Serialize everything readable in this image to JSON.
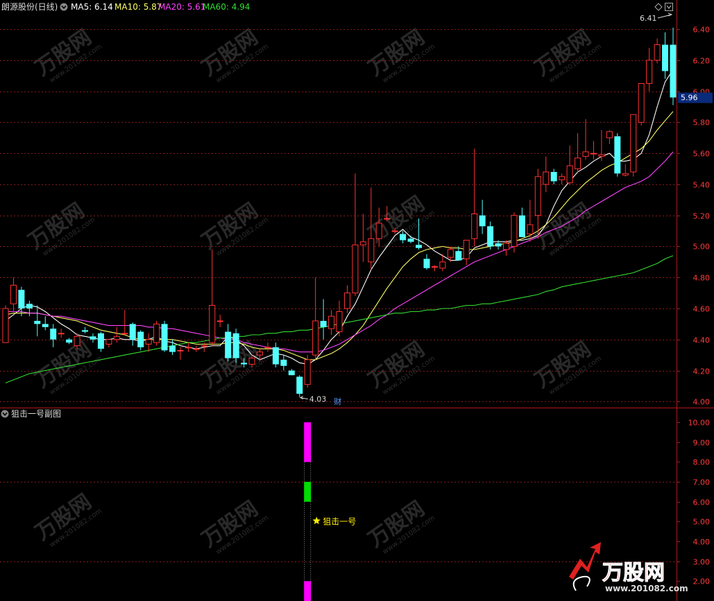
{
  "main_panel": {
    "stock_title": "朗源股份(日线)",
    "ma_legend": [
      {
        "label": "MA5: 6.14",
        "color": "#ffffff"
      },
      {
        "label": "MA10: 5.87",
        "color": "#ffff66"
      },
      {
        "label": "MA20: 5.61",
        "color": "#ff44ff"
      },
      {
        "label": "MA60: 4.94",
        "color": "#33dd33"
      }
    ],
    "current_price_label": "5.96",
    "high_annotation": "6.41",
    "low_annotation": "4.03",
    "event_marker": "财"
  },
  "sub_panel": {
    "title": "狙击一号副图",
    "signal_label": "狙击一号"
  },
  "watermark": {
    "brand": "万股网",
    "url": "www.201082.com"
  },
  "colors": {
    "up": "#ff3232",
    "down": "#54ffff",
    "grid": "#841c1c",
    "axis": "#b01818",
    "magenta_bar": "#ff00ff",
    "green_bar": "#00dd00",
    "star": "#ffee00"
  },
  "chart_data": [
    {
      "type": "candlestick",
      "title": "朗源股份(日线)",
      "ylim": [
        3.97,
        6.49
      ],
      "yticks": [
        4.0,
        4.2,
        4.4,
        4.6,
        4.8,
        5.0,
        5.2,
        5.4,
        5.6,
        5.8,
        6.0,
        6.2,
        6.4
      ],
      "grid": true,
      "candles": [
        [
          4.38,
          4.62,
          4.38,
          4.6
        ],
        [
          4.63,
          4.8,
          4.58,
          4.75
        ],
        [
          4.72,
          4.74,
          4.55,
          4.6
        ],
        [
          4.63,
          4.65,
          4.55,
          4.6
        ],
        [
          4.52,
          4.62,
          4.42,
          4.5
        ],
        [
          4.5,
          4.55,
          4.46,
          4.48
        ],
        [
          4.47,
          4.5,
          4.35,
          4.4
        ],
        [
          4.44,
          4.47,
          4.41,
          4.44
        ],
        [
          4.4,
          4.41,
          4.37,
          4.38
        ],
        [
          4.36,
          4.44,
          4.34,
          4.42
        ],
        [
          4.46,
          4.48,
          4.44,
          4.45
        ],
        [
          4.42,
          4.44,
          4.38,
          4.4
        ],
        [
          4.44,
          4.45,
          4.32,
          4.34
        ],
        [
          4.37,
          4.4,
          4.35,
          4.4
        ],
        [
          4.4,
          4.48,
          4.38,
          4.42
        ],
        [
          4.44,
          4.59,
          4.43,
          4.44
        ],
        [
          4.5,
          4.51,
          4.36,
          4.4
        ],
        [
          4.45,
          4.46,
          4.33,
          4.35
        ],
        [
          4.37,
          4.44,
          4.32,
          4.4
        ],
        [
          4.38,
          4.52,
          4.36,
          4.5
        ],
        [
          4.5,
          4.52,
          4.32,
          4.33
        ],
        [
          4.36,
          4.4,
          4.3,
          4.32
        ],
        [
          4.33,
          4.35,
          4.27,
          4.33
        ],
        [
          4.35,
          4.38,
          4.32,
          4.35
        ],
        [
          4.34,
          4.36,
          4.32,
          4.34
        ],
        [
          4.36,
          4.38,
          4.32,
          4.36
        ],
        [
          4.38,
          4.98,
          4.36,
          4.62
        ],
        [
          4.52,
          4.56,
          4.48,
          4.52
        ],
        [
          4.45,
          4.5,
          4.26,
          4.28
        ],
        [
          4.44,
          4.47,
          4.25,
          4.28
        ],
        [
          4.25,
          4.28,
          4.22,
          4.24
        ],
        [
          4.24,
          4.3,
          4.22,
          4.28
        ],
        [
          4.3,
          4.34,
          4.26,
          4.32
        ],
        [
          4.35,
          4.38,
          4.32,
          4.35
        ],
        [
          4.35,
          4.38,
          4.22,
          4.24
        ],
        [
          4.27,
          4.3,
          4.2,
          4.23
        ],
        [
          4.2,
          4.21,
          4.17,
          4.17
        ],
        [
          4.16,
          4.17,
          4.03,
          4.05
        ],
        [
          4.11,
          4.3,
          4.09,
          4.27
        ],
        [
          4.3,
          4.8,
          4.27,
          4.52
        ],
        [
          4.52,
          4.66,
          4.4,
          4.48
        ],
        [
          4.47,
          4.59,
          4.43,
          4.55
        ],
        [
          4.45,
          4.65,
          4.42,
          4.58
        ],
        [
          4.6,
          4.75,
          4.57,
          4.7
        ],
        [
          4.7,
          5.47,
          4.68,
          5.01
        ],
        [
          5.01,
          5.21,
          4.9,
          5.03
        ],
        [
          4.9,
          5.38,
          4.85,
          5.05
        ],
        [
          5.05,
          5.25,
          5.0,
          5.15
        ],
        [
          5.18,
          5.26,
          5.16,
          5.18
        ],
        [
          5.1,
          5.12,
          5.08,
          5.1
        ],
        [
          5.08,
          5.1,
          5.02,
          5.04
        ],
        [
          5.05,
          5.07,
          5.02,
          5.03
        ],
        [
          5.01,
          5.18,
          4.98,
          4.99
        ],
        [
          4.92,
          4.95,
          4.85,
          4.86
        ],
        [
          4.87,
          4.88,
          4.84,
          4.87
        ],
        [
          4.86,
          4.95,
          4.84,
          4.9
        ],
        [
          4.93,
          5.0,
          4.9,
          4.98
        ],
        [
          4.97,
          5.0,
          4.91,
          4.91
        ],
        [
          4.92,
          5.04,
          4.88,
          5.04
        ],
        [
          5.05,
          5.63,
          5.0,
          5.21
        ],
        [
          5.2,
          5.3,
          5.08,
          5.13
        ],
        [
          5.13,
          5.16,
          4.98,
          5.0
        ],
        [
          5.02,
          5.04,
          4.98,
          5.0
        ],
        [
          4.98,
          5.04,
          4.94,
          5.02
        ],
        [
          5.0,
          5.22,
          4.96,
          5.2
        ],
        [
          5.2,
          5.25,
          5.06,
          5.06
        ],
        [
          5.08,
          5.3,
          5.03,
          5.14
        ],
        [
          5.2,
          5.5,
          5.05,
          5.45
        ],
        [
          5.4,
          5.58,
          5.35,
          5.48
        ],
        [
          5.48,
          5.5,
          5.4,
          5.42
        ],
        [
          5.43,
          5.47,
          5.4,
          5.45
        ],
        [
          5.41,
          5.65,
          5.4,
          5.52
        ],
        [
          5.5,
          5.73,
          5.47,
          5.57
        ],
        [
          5.58,
          5.82,
          5.56,
          5.61
        ],
        [
          5.6,
          5.68,
          5.56,
          5.6
        ],
        [
          5.58,
          5.75,
          5.55,
          5.59
        ],
        [
          5.7,
          5.75,
          5.66,
          5.74
        ],
        [
          5.71,
          5.73,
          5.45,
          5.47
        ],
        [
          5.46,
          5.53,
          5.45,
          5.47
        ],
        [
          5.48,
          5.82,
          5.45,
          5.85
        ],
        [
          5.8,
          6.05,
          5.78,
          6.05
        ],
        [
          6.05,
          6.28,
          6.0,
          6.2
        ],
        [
          6.2,
          6.34,
          6.18,
          6.3
        ],
        [
          6.3,
          6.38,
          6.08,
          6.13
        ],
        [
          6.3,
          6.41,
          5.91,
          5.96
        ]
      ],
      "series": [
        {
          "name": "MA5",
          "color": "#ffffff",
          "values": [
            4.52,
            4.56,
            4.6,
            4.62,
            4.61,
            4.58,
            4.54,
            4.5,
            4.47,
            4.43,
            4.42,
            4.41,
            4.4,
            4.4,
            4.41,
            4.4,
            4.4,
            4.39,
            4.4,
            4.42,
            4.39,
            4.38,
            4.36,
            4.35,
            4.34,
            4.35,
            4.36,
            4.36,
            4.42,
            4.4,
            4.36,
            4.3,
            4.27,
            4.29,
            4.31,
            4.3,
            4.28,
            4.25,
            4.24,
            4.27,
            4.33,
            4.4,
            4.45,
            4.55,
            4.63,
            4.74,
            4.85,
            4.93,
            5.0,
            5.07,
            5.11,
            5.06,
            5.04,
            5.01,
            4.97,
            4.94,
            4.91,
            4.91,
            4.93,
            4.99,
            5.01,
            5.03,
            5.03,
            5.03,
            5.04,
            5.04,
            5.05,
            5.07,
            5.14,
            5.26,
            5.36,
            5.42,
            5.48,
            5.51,
            5.55,
            5.58,
            5.6,
            5.55,
            5.55,
            5.56,
            5.6,
            5.72,
            5.9,
            6.06,
            6.14
          ]
        },
        {
          "name": "MA10",
          "color": "#ffff66",
          "values": [
            4.56,
            4.57,
            4.57,
            4.57,
            4.57,
            4.56,
            4.55,
            4.54,
            4.53,
            4.52,
            4.5,
            4.48,
            4.46,
            4.45,
            4.44,
            4.43,
            4.41,
            4.4,
            4.4,
            4.4,
            4.4,
            4.4,
            4.39,
            4.38,
            4.37,
            4.37,
            4.37,
            4.37,
            4.38,
            4.38,
            4.37,
            4.35,
            4.34,
            4.34,
            4.34,
            4.33,
            4.31,
            4.29,
            4.27,
            4.27,
            4.29,
            4.31,
            4.34,
            4.38,
            4.43,
            4.49,
            4.57,
            4.65,
            4.73,
            4.8,
            4.87,
            4.92,
            4.96,
            4.98,
            4.99,
            5.0,
            4.99,
            4.99,
            4.98,
            4.98,
            4.99,
            5.0,
            5.01,
            5.02,
            5.03,
            5.05,
            5.07,
            5.1,
            5.14,
            5.19,
            5.25,
            5.31,
            5.36,
            5.41,
            5.45,
            5.49,
            5.52,
            5.54,
            5.57,
            5.6,
            5.63,
            5.68,
            5.75,
            5.81,
            5.87
          ]
        },
        {
          "name": "MA20",
          "color": "#ff44ff",
          "values": [
            4.58,
            4.58,
            4.58,
            4.57,
            4.57,
            4.56,
            4.55,
            4.55,
            4.54,
            4.53,
            4.52,
            4.51,
            4.5,
            4.49,
            4.49,
            4.49,
            4.49,
            4.49,
            4.48,
            4.48,
            4.47,
            4.47,
            4.46,
            4.45,
            4.44,
            4.43,
            4.42,
            4.41,
            4.4,
            4.4,
            4.38,
            4.37,
            4.36,
            4.35,
            4.34,
            4.34,
            4.33,
            4.32,
            4.32,
            4.32,
            4.33,
            4.35,
            4.37,
            4.4,
            4.43,
            4.46,
            4.49,
            4.53,
            4.56,
            4.6,
            4.63,
            4.66,
            4.69,
            4.72,
            4.75,
            4.78,
            4.81,
            4.84,
            4.87,
            4.9,
            4.92,
            4.94,
            4.96,
            4.98,
            5.0,
            5.02,
            5.04,
            5.06,
            5.09,
            5.11,
            5.13,
            5.16,
            5.19,
            5.23,
            5.26,
            5.29,
            5.32,
            5.35,
            5.38,
            5.4,
            5.42,
            5.45,
            5.5,
            5.55,
            5.61
          ]
        },
        {
          "name": "MA60",
          "color": "#33dd33",
          "values": [
            4.12,
            4.14,
            4.16,
            4.18,
            4.19,
            4.2,
            4.21,
            4.22,
            4.23,
            4.24,
            4.25,
            4.26,
            4.27,
            4.28,
            4.29,
            4.3,
            4.31,
            4.32,
            4.33,
            4.34,
            4.35,
            4.36,
            4.37,
            4.38,
            4.38,
            4.39,
            4.4,
            4.41,
            4.41,
            4.42,
            4.42,
            4.43,
            4.43,
            4.44,
            4.44,
            4.45,
            4.45,
            4.46,
            4.46,
            4.47,
            4.48,
            4.49,
            4.5,
            4.51,
            4.52,
            4.53,
            4.54,
            4.55,
            4.56,
            4.57,
            4.57,
            4.58,
            4.58,
            4.59,
            4.59,
            4.6,
            4.6,
            4.61,
            4.62,
            4.62,
            4.63,
            4.63,
            4.64,
            4.65,
            4.66,
            4.67,
            4.68,
            4.69,
            4.71,
            4.72,
            4.74,
            4.75,
            4.76,
            4.77,
            4.78,
            4.79,
            4.8,
            4.81,
            4.82,
            4.83,
            4.85,
            4.87,
            4.89,
            4.92,
            4.94
          ]
        }
      ]
    },
    {
      "type": "bar",
      "title": "狙击一号副图",
      "ylim": [
        1.0,
        10.6
      ],
      "yticks": [
        2.0,
        3.0,
        4.0,
        5.0,
        6.0,
        7.0,
        8.0,
        9.0,
        10.0
      ],
      "signal_index": 38,
      "segments": [
        {
          "from": 1.0,
          "to": 2.0,
          "color": "#ff00ff",
          "style": "solid"
        },
        {
          "from": 2.0,
          "to": 6.0,
          "color": "#999999",
          "style": "dotted"
        },
        {
          "from": 6.0,
          "to": 7.0,
          "color": "#00dd00",
          "style": "solid"
        },
        {
          "from": 7.0,
          "to": 8.0,
          "color": "#999999",
          "style": "dotted"
        },
        {
          "from": 8.0,
          "to": 10.0,
          "color": "#ff00ff",
          "style": "solid"
        }
      ],
      "annotation": {
        "y": 5.0,
        "text": "狙击一号"
      }
    }
  ]
}
